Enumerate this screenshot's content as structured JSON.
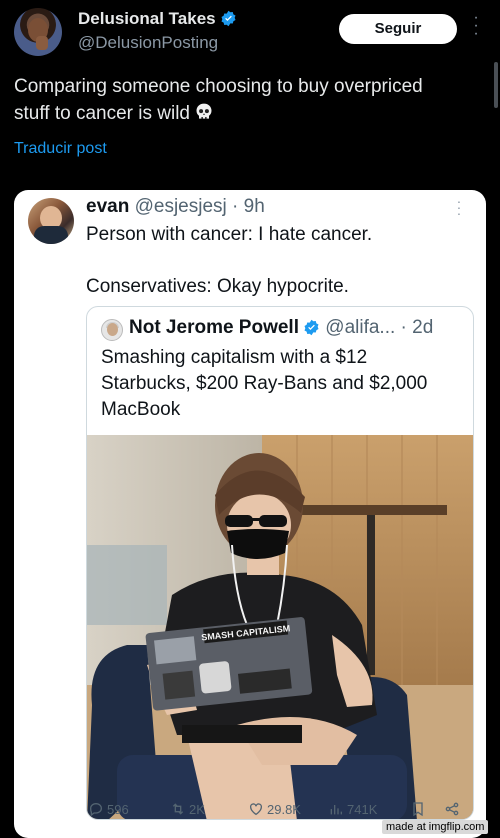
{
  "author": {
    "name": "Delusional Takes",
    "handle": "@DelusionPosting",
    "follow_label": "Seguir"
  },
  "post": {
    "text": "Comparing someone choosing to buy overpriced stuff to cancer is wild",
    "translate_label": "Traducir post"
  },
  "quoted": {
    "name": "evan",
    "handle": "@esjesjesj",
    "time": "· 9h",
    "text": "Person with cancer: I hate cancer.\n\nConservatives: Okay hypocrite.",
    "inner": {
      "name": "Not Jerome Powell",
      "handle": "@alifa...",
      "time": "· 2d",
      "text": "Smashing capitalism with a $12 Starbucks, $200 Ray-Bans and $2,000 MacBook",
      "laptop_sticker": "SMASH CAPITALISM"
    }
  },
  "stats": {
    "replies": "596",
    "reposts": "2K",
    "likes": "29.8K",
    "views": "741K"
  },
  "watermark": "made at imgflip.com",
  "colors": {
    "accent": "#1d9bf0",
    "background": "#000000",
    "card": "#ffffff"
  }
}
